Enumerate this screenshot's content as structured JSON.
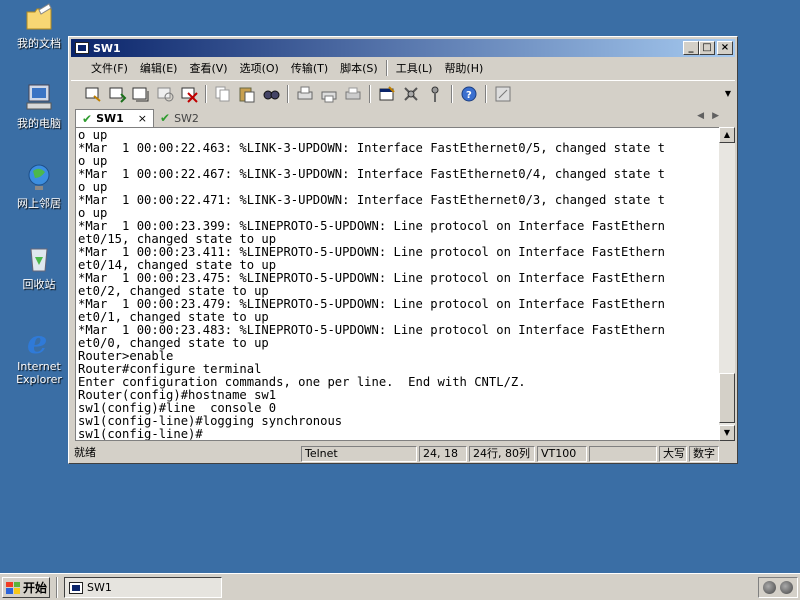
{
  "desktop": {
    "icons": [
      {
        "label": "我的文档",
        "icon": "my-documents-icon"
      },
      {
        "label": "我的电脑",
        "icon": "my-computer-icon"
      },
      {
        "label": "网上邻居",
        "icon": "network-places-icon"
      },
      {
        "label": "回收站",
        "icon": "recycle-bin-icon"
      },
      {
        "label": "Internet Explorer",
        "icon": "internet-explorer-icon"
      }
    ]
  },
  "window": {
    "title": "SW1",
    "menu": [
      "文件(F)",
      "编辑(E)",
      "查看(V)",
      "选项(O)",
      "传输(T)",
      "脚本(S)",
      "工具(L)",
      "帮助(H)"
    ],
    "tabs": [
      {
        "label": "SW1",
        "active": true
      },
      {
        "label": "SW2",
        "active": false
      }
    ],
    "close_tab_glyph": "×",
    "terminal_lines": [
      "o up",
      "*Mar  1 00:00:22.463: %LINK-3-UPDOWN: Interface FastEthernet0/5, changed state t",
      "o up",
      "*Mar  1 00:00:22.467: %LINK-3-UPDOWN: Interface FastEthernet0/4, changed state t",
      "o up",
      "*Mar  1 00:00:22.471: %LINK-3-UPDOWN: Interface FastEthernet0/3, changed state t",
      "o up",
      "*Mar  1 00:00:23.399: %LINEPROTO-5-UPDOWN: Line protocol on Interface FastEthern",
      "et0/15, changed state to up",
      "*Mar  1 00:00:23.411: %LINEPROTO-5-UPDOWN: Line protocol on Interface FastEthern",
      "et0/14, changed state to up",
      "*Mar  1 00:00:23.475: %LINEPROTO-5-UPDOWN: Line protocol on Interface FastEthern",
      "et0/2, changed state to up",
      "*Mar  1 00:00:23.479: %LINEPROTO-5-UPDOWN: Line protocol on Interface FastEthern",
      "et0/1, changed state to up",
      "*Mar  1 00:00:23.483: %LINEPROTO-5-UPDOWN: Line protocol on Interface FastEthern",
      "et0/0, changed state to up",
      "Router>enable",
      "Router#configure terminal",
      "Enter configuration commands, one per line.  End with CNTL/Z.",
      "Router(config)#hostname sw1",
      "sw1(config)#line  console 0",
      "sw1(config-line)#logging synchronous",
      "sw1(config-line)#"
    ],
    "status": {
      "ready": "就绪",
      "protocol": "Telnet",
      "cursor": "24, 18",
      "size": "24行, 80列",
      "emulation": "VT100",
      "caps": "大写",
      "num": "数字"
    }
  },
  "taskbar": {
    "start_label": "开始",
    "task_label": "SW1"
  }
}
